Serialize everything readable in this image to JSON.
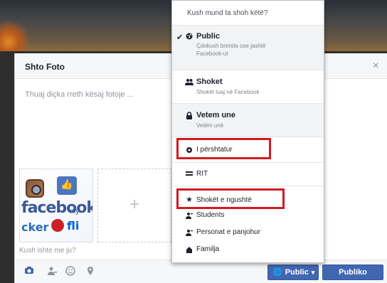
{
  "dialog": {
    "title": "Shto Foto",
    "close_label": "×",
    "caption_placeholder": "Thuaj diçka rreth kësaj fotoje ...",
    "tag_prompt": "Kush ishte me ju?",
    "add_more_label": "+",
    "thumbnail": {
      "brand_text": "facebook",
      "line2_text": "cker",
      "line2_suffix": "fli",
      "small_text": "my"
    }
  },
  "footer": {
    "icons": [
      "camera-icon",
      "person-tag-icon",
      "smile-icon",
      "location-pin-icon"
    ],
    "public_button": "Public",
    "publish_button": "Publiko"
  },
  "audience_menu": {
    "heading": "Kush mund ta shoh këtë?",
    "items": [
      {
        "label": "Public",
        "subtitle_line1": "Çdokush brenda ose jashtë",
        "subtitle_line2": "Facebook-ut",
        "icon": "globe-icon",
        "selected": true
      },
      {
        "label": "Shoket",
        "subtitle_line1": "Shokët tuaj në Facebook",
        "icon": "friends-icon",
        "selected": false
      },
      {
        "label": "Vetem une",
        "subtitle_line1": "Vetëm unë",
        "icon": "lock-icon",
        "selected": false
      },
      {
        "label": "I përshtatur",
        "icon": "gear-icon"
      },
      {
        "label": "RIT",
        "icon": "group-icon"
      },
      {
        "label": "Shokët e ngushtë",
        "icon": "star-icon"
      },
      {
        "label": "Students",
        "icon": "list-icon"
      },
      {
        "label": "Personat e panjohur",
        "icon": "list-icon"
      },
      {
        "label": "Familja",
        "icon": "family-icon"
      }
    ]
  },
  "colors": {
    "fb_blue": "#4267b2",
    "highlight_red": "#d21a20",
    "menu_selected_bg": "#f2f3f5"
  }
}
